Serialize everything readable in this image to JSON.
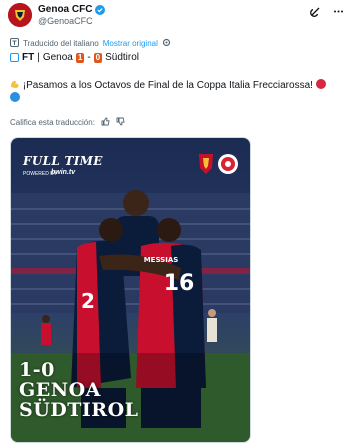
{
  "account": {
    "name": "Genoa CFC",
    "handle": "@GenoaCFC"
  },
  "icons": {
    "avatar": "genoa-crest-icon",
    "verified": "verified-badge-icon",
    "grok": "grok-icon",
    "more": "more-icon",
    "translate": "translate-icon",
    "settings": "gear-icon",
    "thumbs_up": "thumbs-up-icon",
    "thumbs_down": "thumbs-down-icon"
  },
  "translation": {
    "note": "Traducido del italiano",
    "show_original": "Mostrar original",
    "rate_prompt": "Califica esta traducción:"
  },
  "tweet": {
    "ft_label": "FT",
    "separator": "|",
    "home_team": "Genoa",
    "home_score": "1",
    "dash": "-",
    "away_score": "0",
    "away_team": "Südtirol",
    "message": "¡Pasamos a los Octavos de Final de la Coppa Italia Frecciarossa!"
  },
  "media": {
    "full_time": "FULL TIME",
    "powered_by": "POWERED BY",
    "sponsor": "bwin.tv",
    "score_line": "1-0",
    "home_team": "GENOA",
    "away_team": "SÜDTIROL",
    "shirt_number_right": "16",
    "shirt_number_left": "2",
    "shirt_name": "MESSIAS"
  },
  "colors": {
    "link": "#1d9bf0",
    "genoa_red": "#c8102e",
    "genoa_blue": "#0b1b3a",
    "score_orange": "#e0561d"
  }
}
